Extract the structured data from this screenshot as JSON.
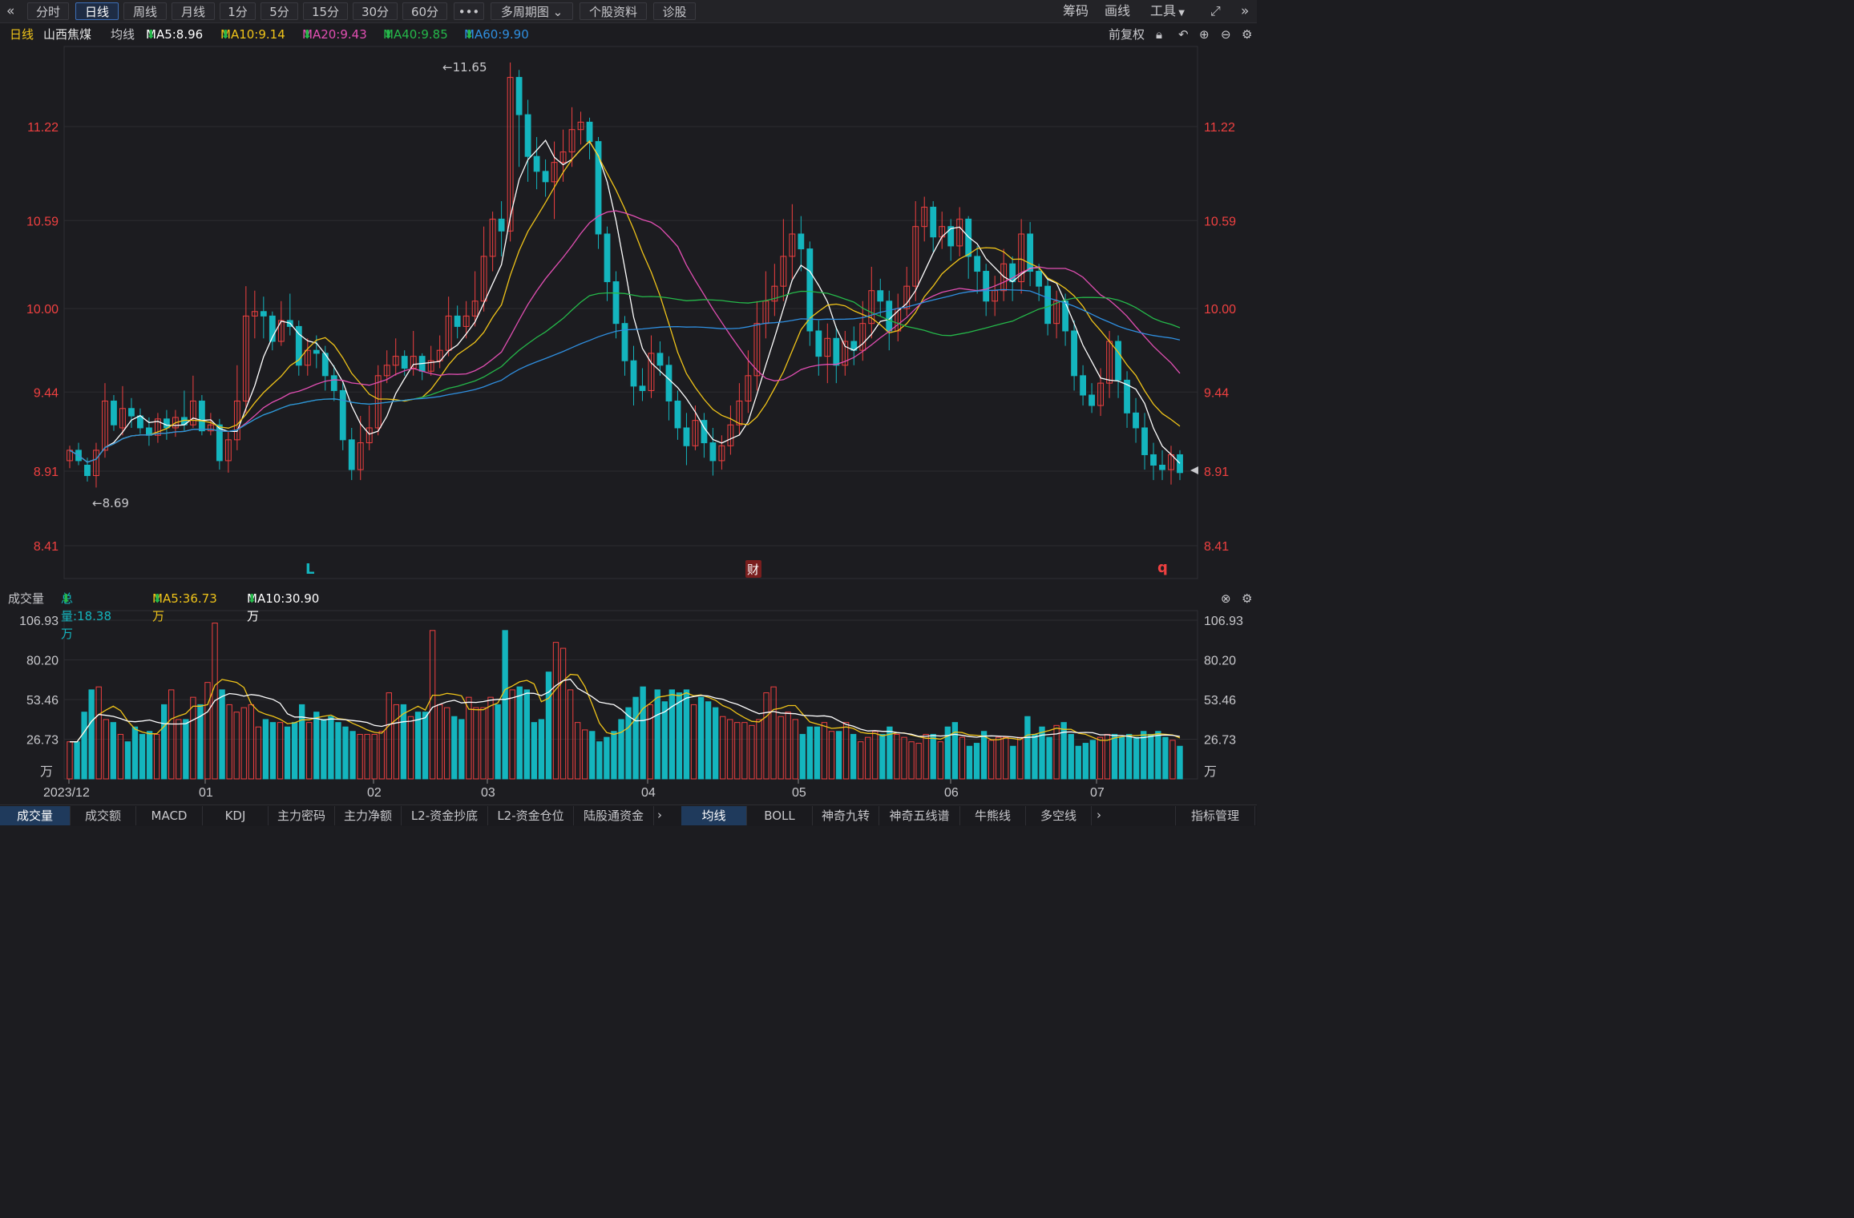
{
  "toolbar": {
    "back_icon": "double-chevron-left-icon",
    "periods": [
      "分时",
      "日线",
      "周线",
      "月线",
      "1分",
      "5分",
      "15分",
      "30分",
      "60分"
    ],
    "active_period": "日线",
    "more_label": "•••",
    "multi_period_label": "多周期图",
    "stock_info_label": "个股资料",
    "diagnose_label": "诊股",
    "right_items": [
      "筹码",
      "画线",
      "工具"
    ],
    "expand_icon": "fullscreen-icon",
    "next_icon": "double-chevron-right-icon"
  },
  "info": {
    "period": "日线",
    "stock_name": "山西焦煤",
    "ma_label": "均线",
    "ma5": "MA5:8.96",
    "ma10": "MA10:9.14",
    "ma20": "MA20:9.43",
    "ma40": "MA40:9.85",
    "ma60": "MA60:9.90",
    "adjust": "前复权"
  },
  "colors": {
    "up": "#ef4040",
    "down": "#14b5be",
    "ma5": "#ffffff",
    "ma10": "#f0c419",
    "ma20": "#e24fb3",
    "ma40": "#25b84a",
    "ma60": "#2f8fe0",
    "axis_text": "#ef4040"
  },
  "volume_info": {
    "title": "成交量",
    "total": "总量:18.38万",
    "ma5": "MA5:36.73万",
    "ma10": "MA10:30.90万"
  },
  "bottom_tabs": [
    "成交量",
    "成交额",
    "MACD",
    "KDJ",
    "主力密码",
    "主力净额",
    "L2-资金抄底",
    "L2-资金仓位",
    "陆股通资金"
  ],
  "indicator_tabs": [
    "均线",
    "BOLL",
    "神奇九转",
    "神奇五线谱",
    "牛熊线",
    "多空线"
  ],
  "indicator_manage": "指标管理",
  "chart_data": {
    "type": "candlestick",
    "price_axis": {
      "ticks": [
        "11.22",
        "10.59",
        "10.00",
        "9.44",
        "8.91",
        "8.41"
      ],
      "range": [
        8.41,
        11.65
      ]
    },
    "volume_axis": {
      "ticks": [
        "106.93",
        "80.20",
        "53.46",
        "26.73"
      ],
      "unit": "万"
    },
    "x_labels": [
      "2023/12",
      "01",
      "02",
      "03",
      "04",
      "05",
      "06",
      "07"
    ],
    "annotations": {
      "high": "←11.65",
      "low": "←8.69",
      "markers": [
        "L",
        "财",
        "q"
      ]
    },
    "candles": [
      [
        8.98,
        9.05,
        9.08,
        8.93
      ],
      [
        9.05,
        8.98,
        9.1,
        8.95
      ],
      [
        8.95,
        8.88,
        9.0,
        8.84
      ],
      [
        8.88,
        9.05,
        9.1,
        8.8
      ],
      [
        9.05,
        9.38,
        9.5,
        9.0
      ],
      [
        9.38,
        9.22,
        9.42,
        9.18
      ],
      [
        9.2,
        9.33,
        9.48,
        9.15
      ],
      [
        9.33,
        9.28,
        9.4,
        9.2
      ],
      [
        9.28,
        9.2,
        9.33,
        9.16
      ],
      [
        9.2,
        9.15,
        9.27,
        9.08
      ],
      [
        9.15,
        9.26,
        9.3,
        9.1
      ],
      [
        9.26,
        9.2,
        9.32,
        9.12
      ],
      [
        9.2,
        9.27,
        9.32,
        9.14
      ],
      [
        9.27,
        9.22,
        9.45,
        9.18
      ],
      [
        9.22,
        9.38,
        9.55,
        9.2
      ],
      [
        9.38,
        9.18,
        9.42,
        9.15
      ],
      [
        9.18,
        9.22,
        9.3,
        9.15
      ],
      [
        9.22,
        8.98,
        9.26,
        8.92
      ],
      [
        8.98,
        9.12,
        9.18,
        8.9
      ],
      [
        9.12,
        9.38,
        9.62,
        9.05
      ],
      [
        9.38,
        9.95,
        10.15,
        9.3
      ],
      [
        9.95,
        9.98,
        10.12,
        9.8
      ],
      [
        9.98,
        9.95,
        10.08,
        9.8
      ],
      [
        9.95,
        9.78,
        9.98,
        9.72
      ],
      [
        9.78,
        9.92,
        10.05,
        9.75
      ],
      [
        9.92,
        9.88,
        10.1,
        9.82
      ],
      [
        9.88,
        9.62,
        9.92,
        9.55
      ],
      [
        9.62,
        9.72,
        9.8,
        9.55
      ],
      [
        9.72,
        9.7,
        9.82,
        9.6
      ],
      [
        9.7,
        9.55,
        9.75,
        9.45
      ],
      [
        9.55,
        9.45,
        9.62,
        9.38
      ],
      [
        9.45,
        9.12,
        9.5,
        9.05
      ],
      [
        9.12,
        8.92,
        9.2,
        8.85
      ],
      [
        8.92,
        9.1,
        9.28,
        8.85
      ],
      [
        9.1,
        9.2,
        9.35,
        9.05
      ],
      [
        9.2,
        9.55,
        9.62,
        9.15
      ],
      [
        9.55,
        9.62,
        9.72,
        9.5
      ],
      [
        9.62,
        9.68,
        9.8,
        9.55
      ],
      [
        9.68,
        9.6,
        9.72,
        9.55
      ],
      [
        9.6,
        9.68,
        9.85,
        9.55
      ],
      [
        9.68,
        9.58,
        9.7,
        9.52
      ],
      [
        9.58,
        9.65,
        9.75,
        9.55
      ],
      [
        9.65,
        9.72,
        9.82,
        9.6
      ],
      [
        9.72,
        9.95,
        10.08,
        9.68
      ],
      [
        9.95,
        9.88,
        10.02,
        9.8
      ],
      [
        9.88,
        9.95,
        10.05,
        9.8
      ],
      [
        9.95,
        10.05,
        10.25,
        9.88
      ],
      [
        10.05,
        10.35,
        10.55,
        9.98
      ],
      [
        10.35,
        10.6,
        10.65,
        10.25
      ],
      [
        10.6,
        10.52,
        10.72,
        10.35
      ],
      [
        10.52,
        11.55,
        11.65,
        10.45
      ],
      [
        11.55,
        11.3,
        11.6,
        10.95
      ],
      [
        11.3,
        11.02,
        11.4,
        10.85
      ],
      [
        11.02,
        10.92,
        11.15,
        10.8
      ],
      [
        10.92,
        10.85,
        11.0,
        10.75
      ],
      [
        10.85,
        10.98,
        11.12,
        10.6
      ],
      [
        10.98,
        11.05,
        11.2,
        10.85
      ],
      [
        11.05,
        11.2,
        11.35,
        10.95
      ],
      [
        11.2,
        11.25,
        11.32,
        11.1
      ],
      [
        11.25,
        11.12,
        11.28,
        11.0
      ],
      [
        11.12,
        10.5,
        11.15,
        10.4
      ],
      [
        10.5,
        10.18,
        10.55,
        10.05
      ],
      [
        10.18,
        9.9,
        10.25,
        9.8
      ],
      [
        9.9,
        9.65,
        9.95,
        9.55
      ],
      [
        9.65,
        9.48,
        9.75,
        9.35
      ],
      [
        9.48,
        9.45,
        9.6,
        9.38
      ],
      [
        9.45,
        9.7,
        9.82,
        9.4
      ],
      [
        9.7,
        9.62,
        9.78,
        9.55
      ],
      [
        9.62,
        9.38,
        9.68,
        9.25
      ],
      [
        9.38,
        9.2,
        9.45,
        9.12
      ],
      [
        9.2,
        9.08,
        9.3,
        8.95
      ],
      [
        9.08,
        9.25,
        9.35,
        9.05
      ],
      [
        9.25,
        9.1,
        9.3,
        9.0
      ],
      [
        9.1,
        8.98,
        9.2,
        8.88
      ],
      [
        8.98,
        9.08,
        9.15,
        8.92
      ],
      [
        9.08,
        9.22,
        9.35,
        9.02
      ],
      [
        9.22,
        9.38,
        9.5,
        9.15
      ],
      [
        9.38,
        9.55,
        9.72,
        9.3
      ],
      [
        9.55,
        9.9,
        10.05,
        9.45
      ],
      [
        9.9,
        10.05,
        10.25,
        9.8
      ],
      [
        10.05,
        10.15,
        10.3,
        9.95
      ],
      [
        10.15,
        10.35,
        10.6,
        10.05
      ],
      [
        10.35,
        10.5,
        10.7,
        10.2
      ],
      [
        10.5,
        10.4,
        10.62,
        10.25
      ],
      [
        10.4,
        9.85,
        10.45,
        9.75
      ],
      [
        9.85,
        9.68,
        9.92,
        9.55
      ],
      [
        9.68,
        9.8,
        9.9,
        9.5
      ],
      [
        9.8,
        9.62,
        9.88,
        9.5
      ],
      [
        9.62,
        9.78,
        9.85,
        9.55
      ],
      [
        9.78,
        9.72,
        9.88,
        9.62
      ],
      [
        9.72,
        9.9,
        10.05,
        9.65
      ],
      [
        9.9,
        10.12,
        10.28,
        9.8
      ],
      [
        10.12,
        10.05,
        10.2,
        9.95
      ],
      [
        10.05,
        9.85,
        10.12,
        9.72
      ],
      [
        9.85,
        10.0,
        10.1,
        9.78
      ],
      [
        10.0,
        10.15,
        10.28,
        9.95
      ],
      [
        10.15,
        10.55,
        10.72,
        10.05
      ],
      [
        10.55,
        10.68,
        10.75,
        10.45
      ],
      [
        10.68,
        10.48,
        10.72,
        10.38
      ],
      [
        10.48,
        10.55,
        10.65,
        10.4
      ],
      [
        10.55,
        10.42,
        10.6,
        10.32
      ],
      [
        10.42,
        10.6,
        10.68,
        10.35
      ],
      [
        10.6,
        10.35,
        10.62,
        10.2
      ],
      [
        10.35,
        10.25,
        10.42,
        10.1
      ],
      [
        10.25,
        10.05,
        10.3,
        9.95
      ],
      [
        10.05,
        10.12,
        10.22,
        9.95
      ],
      [
        10.12,
        10.3,
        10.4,
        10.05
      ],
      [
        10.3,
        10.18,
        10.35,
        10.05
      ],
      [
        10.18,
        10.5,
        10.6,
        10.1
      ],
      [
        10.5,
        10.25,
        10.58,
        10.15
      ],
      [
        10.25,
        10.15,
        10.3,
        10.05
      ],
      [
        10.15,
        9.9,
        10.2,
        9.82
      ],
      [
        9.9,
        10.05,
        10.12,
        9.8
      ],
      [
        10.05,
        9.85,
        10.1,
        9.75
      ],
      [
        9.85,
        9.55,
        9.92,
        9.45
      ],
      [
        9.55,
        9.42,
        9.62,
        9.35
      ],
      [
        9.42,
        9.35,
        9.5,
        9.3
      ],
      [
        9.35,
        9.5,
        9.6,
        9.28
      ],
      [
        9.5,
        9.78,
        9.85,
        9.4
      ],
      [
        9.78,
        9.52,
        9.82,
        9.4
      ],
      [
        9.52,
        9.3,
        9.58,
        9.2
      ],
      [
        9.3,
        9.2,
        9.4,
        9.1
      ],
      [
        9.2,
        9.02,
        9.3,
        8.92
      ],
      [
        9.02,
        8.95,
        9.1,
        8.85
      ],
      [
        8.95,
        8.92,
        9.05,
        8.85
      ],
      [
        8.92,
        9.02,
        9.08,
        8.82
      ],
      [
        9.02,
        8.9,
        9.05,
        8.85
      ]
    ],
    "volumes": [
      25,
      25,
      45,
      60,
      62,
      40,
      38,
      30,
      25,
      35,
      30,
      32,
      30,
      50,
      60,
      40,
      40,
      55,
      50,
      65,
      105,
      60,
      50,
      45,
      48,
      50,
      35,
      40,
      38,
      38,
      35,
      38,
      50,
      38,
      45,
      40,
      42,
      38,
      35,
      32,
      30,
      30,
      30,
      32,
      58,
      50,
      50,
      42,
      45,
      45,
      100,
      50,
      48,
      42,
      40,
      55,
      48,
      48,
      55,
      50,
      100,
      60,
      62,
      60,
      38,
      40,
      72,
      92,
      88,
      60,
      38,
      33,
      32,
      25,
      28,
      32,
      40,
      48,
      55,
      62,
      50,
      60,
      52,
      60,
      58,
      60,
      50,
      55,
      52,
      48,
      42,
      40,
      38,
      38,
      36,
      40,
      58,
      62,
      42,
      45,
      40,
      30,
      35,
      35,
      38,
      32,
      32,
      38,
      30,
      25,
      28,
      32,
      30,
      35,
      30,
      28,
      25,
      24,
      30,
      30,
      25,
      35,
      38,
      28,
      22,
      24,
      32,
      26,
      28,
      28,
      22,
      28,
      42,
      30,
      35,
      28,
      36,
      38,
      30,
      22,
      24,
      26,
      28,
      30,
      30,
      28,
      30,
      28,
      32,
      30,
      32,
      28,
      26,
      22
    ]
  }
}
